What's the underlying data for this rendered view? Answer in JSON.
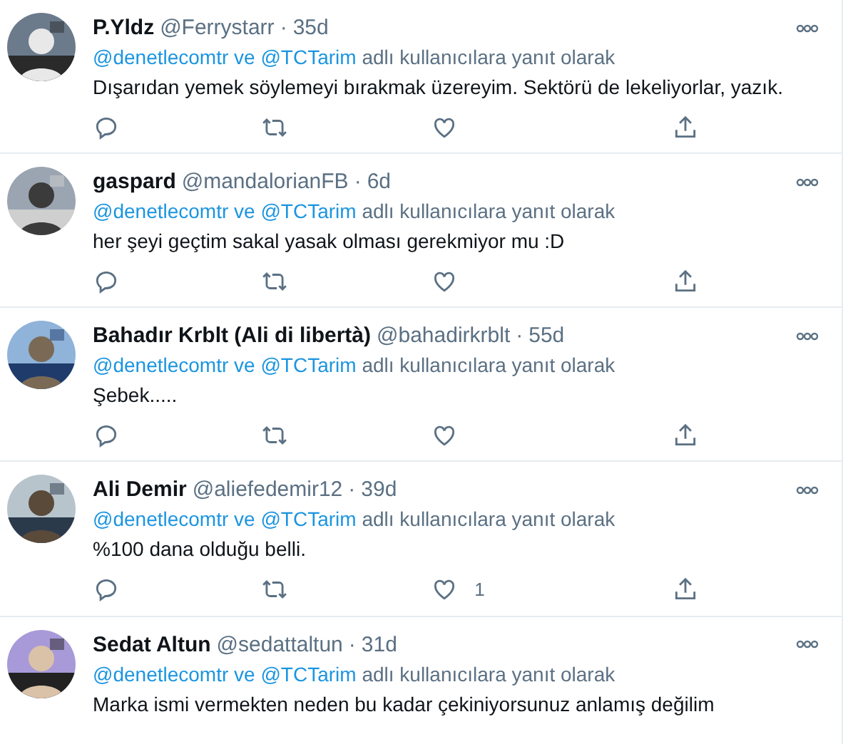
{
  "tweets": [
    {
      "name": "P.Yldz",
      "handle": "@Ferrystarr",
      "separator": "·",
      "time": "35d",
      "reply_link": "@denetlecomtr ve @TCTarim",
      "reply_suffix": "adlı kullanıcılara yanıt olarak",
      "text": "Dışarıdan yemek söylemeyi bırakmak üzereyim. Sektörü de lekeliyorlar, yazık.",
      "actions_visible": true
    },
    {
      "name": "gaspard",
      "handle": "@mandalorianFB",
      "separator": "·",
      "time": "6d",
      "reply_link": "@denetlecomtr ve @TCTarim",
      "reply_suffix": "adlı kullanıcılara yanıt olarak",
      "text": "her şeyi geçtim sakal yasak olması gerekmiyor mu :D",
      "actions_visible": true
    },
    {
      "name": "Bahadır Krblt (Ali di libertà)",
      "handle": "@bahadirkrblt",
      "separator": "·",
      "time": "55d",
      "reply_link": "@denetlecomtr ve @TCTarim",
      "reply_suffix": "adlı kullanıcılara yanıt olarak",
      "text": "Şebek.....",
      "actions_visible": true
    },
    {
      "name": "Ali Demir",
      "handle": "@aliefedemir12",
      "separator": "·",
      "time": "39d",
      "reply_link": "@denetlecomtr ve @TCTarim",
      "reply_suffix": "adlı kullanıcılara yanıt olarak",
      "text": "%100 dana olduğu belli.",
      "like_count": "1",
      "actions_visible": true
    },
    {
      "name": "Sedat Altun",
      "handle": "@sedattaltun",
      "separator": "·",
      "time": "31d",
      "reply_link": "@denetlecomtr ve @TCTarim",
      "reply_suffix": "adlı kullanıcılara yanıt olarak",
      "text": "Marka ismi vermekten neden bu kadar çekiniyorsunuz anlamış değilim",
      "actions_visible": false
    }
  ]
}
